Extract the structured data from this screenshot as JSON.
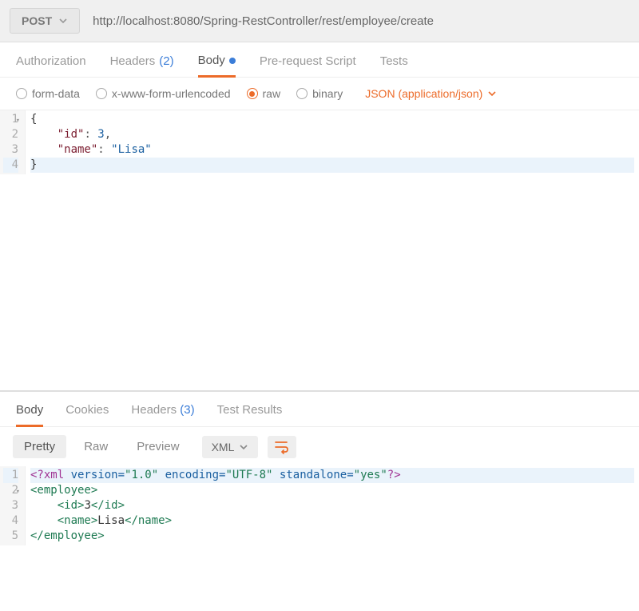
{
  "topbar": {
    "method": "POST",
    "url": "http://localhost:8080/Spring-RestController/rest/employee/create"
  },
  "reqTabs": {
    "authorization": "Authorization",
    "headers": "Headers",
    "headersCount": "(2)",
    "body": "Body",
    "prerequest": "Pre-request Script",
    "tests": "Tests"
  },
  "bodyTypes": {
    "formData": "form-data",
    "urlencoded": "x-www-form-urlencoded",
    "raw": "raw",
    "binary": "binary",
    "contentType": "JSON (application/json)"
  },
  "reqEditor": {
    "ln1": "1",
    "ln2": "2",
    "ln3": "3",
    "ln4": "4",
    "l1": "{",
    "l2_indent": "    ",
    "l2_key": "\"id\"",
    "l2_colon": ": ",
    "l2_val": "3",
    "l2_comma": ",",
    "l3_indent": "    ",
    "l3_key": "\"name\"",
    "l3_colon": ": ",
    "l3_val": "\"Lisa\"",
    "l4": "}"
  },
  "respTabs": {
    "body": "Body",
    "cookies": "Cookies",
    "headers": "Headers",
    "headersCount": "(3)",
    "testResults": "Test Results"
  },
  "viewRow": {
    "pretty": "Pretty",
    "raw": "Raw",
    "preview": "Preview",
    "format": "XML"
  },
  "respEditor": {
    "ln1": "1",
    "ln2": "2",
    "ln3": "3",
    "ln4": "4",
    "ln5": "5",
    "l1_a": "<?xml ",
    "l1_b": "version=",
    "l1_c": "\"1.0\"",
    "l1_d": " encoding=",
    "l1_e": "\"UTF-8\"",
    "l1_f": " standalone=",
    "l1_g": "\"yes\"",
    "l1_h": "?>",
    "l2": "<employee>",
    "l3_indent": "    ",
    "l3_open": "<id>",
    "l3_txt": "3",
    "l3_close": "</id>",
    "l4_indent": "    ",
    "l4_open": "<name>",
    "l4_txt": "Lisa",
    "l4_close": "</name>",
    "l5": "</employee>"
  }
}
